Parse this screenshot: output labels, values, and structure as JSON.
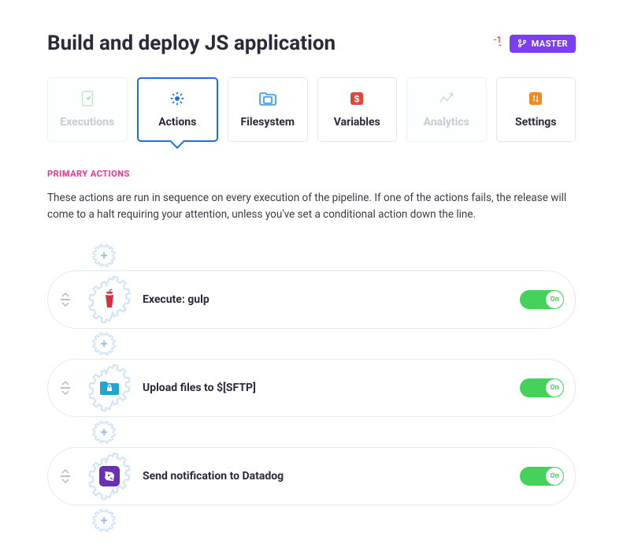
{
  "header": {
    "title": "Build and deploy JS application",
    "count": "-1",
    "branch_label": "MASTER"
  },
  "tabs": [
    {
      "label": "Executions",
      "icon": "executions-icon",
      "state": "disabled"
    },
    {
      "label": "Actions",
      "icon": "actions-icon",
      "state": "active"
    },
    {
      "label": "Filesystem",
      "icon": "filesystem-icon",
      "state": "normal"
    },
    {
      "label": "Variables",
      "icon": "variables-icon",
      "state": "normal"
    },
    {
      "label": "Analytics",
      "icon": "analytics-icon",
      "state": "disabled"
    },
    {
      "label": "Settings",
      "icon": "settings-icon",
      "state": "normal"
    }
  ],
  "section": {
    "label": "PRIMARY ACTIONS",
    "description": "These actions are run in sequence on every execution of the pipeline. If one of the actions fails, the release will come to a halt requiring your attention, unless you've set a conditional action down the line."
  },
  "actions": [
    {
      "title": "Execute: gulp",
      "icon": "gulp-icon",
      "icon_color": "#d7303f",
      "toggle": "On",
      "toggle_on": true
    },
    {
      "title": "Upload files to $[SFTP]",
      "icon": "folder-lock-icon",
      "icon_color": "#1fa7d0",
      "toggle": "On",
      "toggle_on": true
    },
    {
      "title": "Send notification to Datadog",
      "icon": "datadog-icon",
      "icon_color": "#6a2fb3",
      "toggle": "On",
      "toggle_on": true
    }
  ],
  "colors": {
    "accent_blue": "#1a6fe8",
    "pink": "#ff2e92",
    "purple": "#7a3ff2",
    "toggle_green": "#45d25a"
  }
}
